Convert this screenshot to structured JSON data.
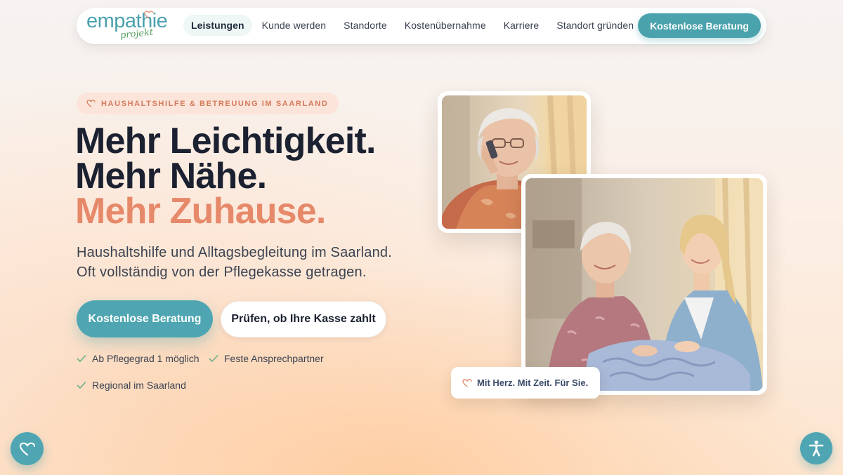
{
  "brand": {
    "logo_word": "empathie",
    "logo_sub": "projekt"
  },
  "nav": {
    "items": [
      "Leistungen",
      "Kunde werden",
      "Standorte",
      "Kostenübernahme",
      "Karriere",
      "Standort gründen"
    ],
    "active_index": 0,
    "cta_label": "Kostenlose Beratung"
  },
  "hero": {
    "badge": "HAUSHALTSHILFE & BETREUUNG IM SAARLAND",
    "headline": {
      "line1": "Mehr Leichtigkeit.",
      "line2": "Mehr Nähe.",
      "line3": "Mehr Zuhause."
    },
    "lead": "Haushaltshilfe und Alltagsbegleitung im Saarland. Oft vollständig von der Pflegekasse getragen.",
    "primary_button": "Kostenlose Beratung",
    "secondary_button": "Prüfen, ob Ihre Kasse zahlt",
    "checks": [
      "Ab Pflegegrad 1 möglich",
      "Feste Ansprechpartner",
      "Regional im Saarland"
    ]
  },
  "photo_tag": "Mit Herz. Mit Zeit. Für Sie.",
  "colors": {
    "accent_teal": "#4fa6b2",
    "accent_coral": "#e6896a",
    "heading": "#1b2130",
    "check_green": "#6bb08a"
  },
  "icons": {
    "badge": "heart-icon",
    "check": "check-icon",
    "tag": "heart-icon",
    "fab_left": "heart-icon",
    "fab_right": "accessibility-icon"
  }
}
